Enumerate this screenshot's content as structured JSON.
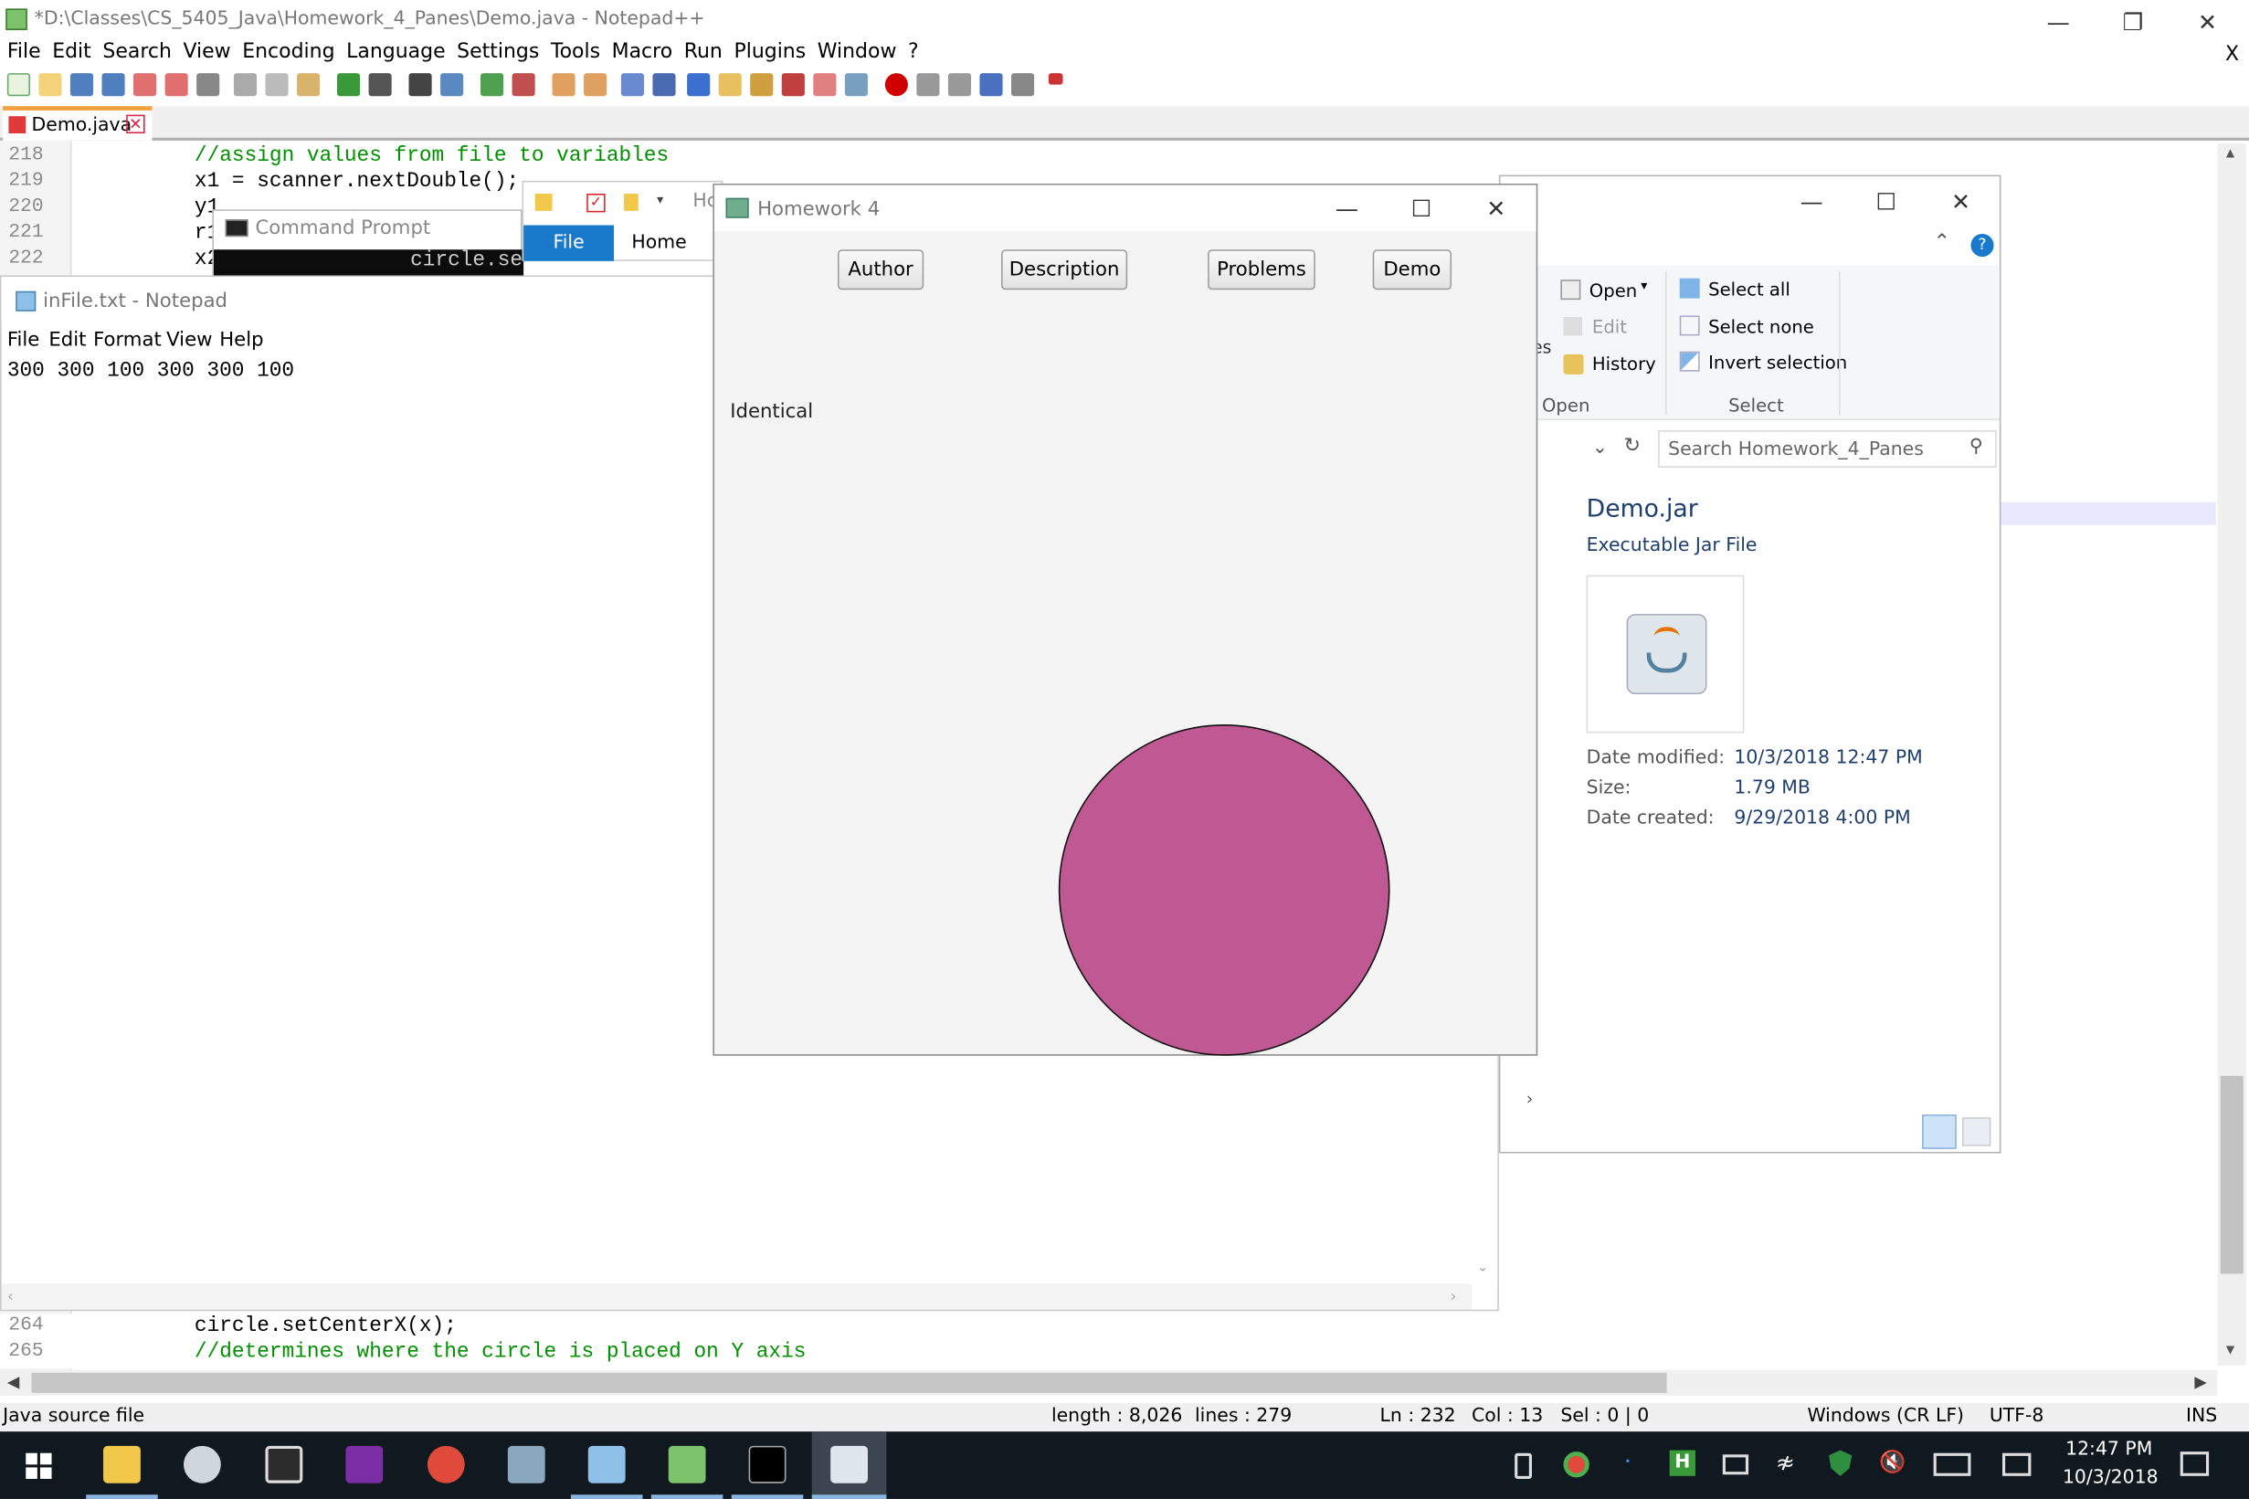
{
  "npp": {
    "title": "*D:\\Classes\\CS_5405_Java\\Homework_4_Panes\\Demo.java - Notepad++",
    "close_x": "X",
    "menu": [
      "File",
      "Edit",
      "Search",
      "View",
      "Encoding",
      "Language",
      "Settings",
      "Tools",
      "Macro",
      "Run",
      "Plugins",
      "Window",
      "?"
    ],
    "tab": "Demo.java",
    "lines_top": [
      {
        "n": "218",
        "text": "        //assign values from file to variables",
        "comment": true
      },
      {
        "n": "219",
        "text": "        x1 = scanner.nextDouble();",
        "comment": false
      },
      {
        "n": "220",
        "text": "        y1",
        "comment": false
      },
      {
        "n": "221",
        "text": "        r1",
        "comment": false
      },
      {
        "n": "222",
        "text": "        x2",
        "comment": false
      }
    ],
    "lines_bottom": [
      {
        "n": "264",
        "text": "        circle.setCenterX(x);",
        "comment": false
      },
      {
        "n": "265",
        "text": "        //determines where the circle is placed on Y axis",
        "comment": true
      }
    ],
    "status": {
      "type": "Java source file",
      "length": "length : 8,026",
      "lines": "lines : 279",
      "ln": "Ln : 232",
      "col": "Col : 13",
      "sel": "Sel : 0 | 0",
      "eol": "Windows (CR LF)",
      "enc": "UTF-8",
      "mode": "INS"
    }
  },
  "cmd": {
    "title": "Command Prompt",
    "text": "circle.se"
  },
  "notepad": {
    "title": "inFile.txt - Notepad",
    "menu": [
      "File",
      "Edit",
      "Format",
      "View",
      "Help"
    ],
    "content": "300 300 100 300 300 100"
  },
  "explorer_mini": {
    "file_tab": "File",
    "home_tab": "Home",
    "extra": "Hc"
  },
  "explorer": {
    "open_btn": "Open",
    "edit_btn": "Edit",
    "history_btn": "History",
    "group_open": "Open",
    "frag": "es",
    "select_all": "Select all",
    "select_none": "Select none",
    "invert": "Invert selection",
    "group_select": "Select",
    "search_placeholder": "Search Homework_4_Panes",
    "file_name": "Demo.jar",
    "file_type": "Executable Jar File",
    "date_modified_label": "Date modified:",
    "date_modified": "10/3/2018 12:47 PM",
    "size_label": "Size:",
    "size": "1.79 MB",
    "date_created_label": "Date created:",
    "date_created": "9/29/2018 4:00 PM"
  },
  "fx": {
    "title": "Homework 4",
    "buttons": [
      "Author",
      "Description",
      "Problems",
      "Demo"
    ],
    "label": "Identical",
    "circle_fill": "#bf5893"
  },
  "taskbar": {
    "time": "12:47 PM",
    "date": "10/3/2018"
  }
}
